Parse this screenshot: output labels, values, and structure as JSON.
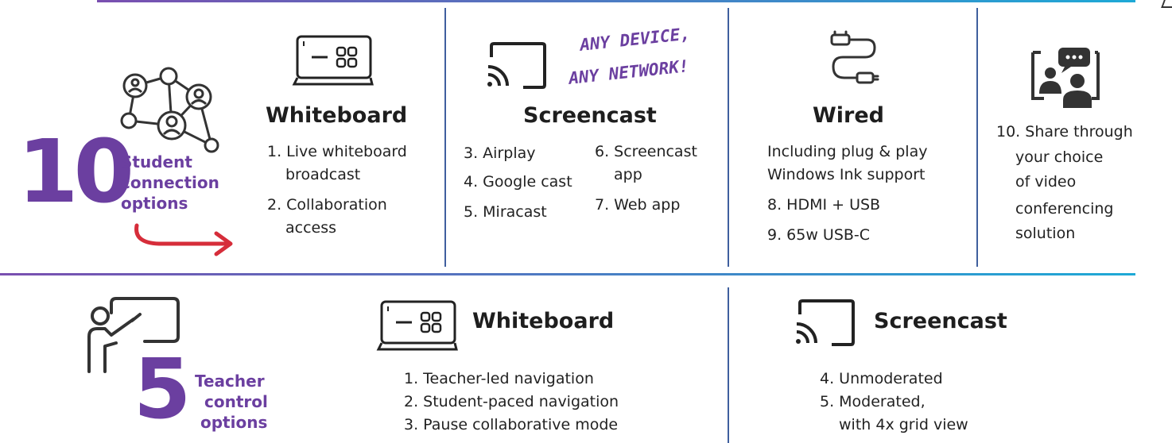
{
  "colors": {
    "purple": "#6b3fa0",
    "blue_divider": "#3f5f9e",
    "arrow_red": "#d62d3a",
    "rule_start": "#7a4fb0",
    "rule_end": "#1ea9d6"
  },
  "top": {
    "count": "10",
    "label": [
      "Student",
      "connection",
      "options"
    ],
    "whiteboard": {
      "title": "Whiteboard",
      "items": [
        "1. Live whiteboard",
        "broadcast",
        "2. Collaboration",
        "access"
      ]
    },
    "screencast": {
      "title": "Screencast",
      "tagline": [
        "ANY DEVICE,",
        "ANY NETWORK!"
      ],
      "items_left": [
        "3. Airplay",
        "4. Google cast",
        "5. Miracast"
      ],
      "items_right": [
        "6. Screencast",
        "app",
        "7. Web app"
      ]
    },
    "wired": {
      "title": "Wired",
      "items": [
        "Including plug & play",
        "Windows Ink support",
        "8. HDMI + USB",
        "9. 65w USB-C"
      ]
    },
    "video": {
      "items": [
        "10. Share through",
        "your choice",
        "of video",
        "conferencing",
        "solution"
      ]
    }
  },
  "bottom": {
    "count": "5",
    "label": [
      "Teacher",
      "control",
      "options"
    ],
    "whiteboard": {
      "title": "Whiteboard",
      "items": [
        "1. Teacher-led navigation",
        "2. Student-paced navigation",
        "3. Pause collaborative mode"
      ]
    },
    "screencast": {
      "title": "Screencast",
      "items": [
        "4. Unmoderated",
        "5. Moderated,",
        "with 4x grid view"
      ]
    }
  },
  "icons": [
    "people-network-icon",
    "whiteboard-icon",
    "cast-icon",
    "cable-icon",
    "video-conference-icon",
    "teacher-board-icon"
  ]
}
